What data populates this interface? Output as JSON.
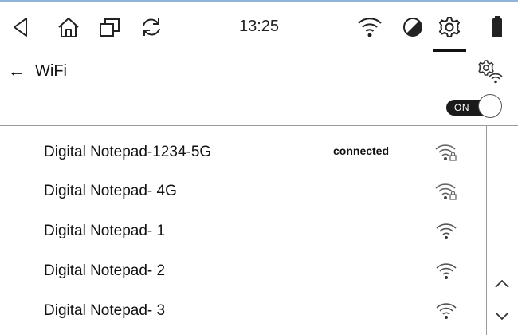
{
  "statusbar": {
    "clock": "13:25",
    "icons": [
      "back-triangle-icon",
      "home-icon",
      "recent-apps-icon",
      "refresh-icon",
      "wifi-icon",
      "contrast-icon",
      "settings-gear-icon",
      "battery-icon"
    ],
    "active_tab": "settings"
  },
  "header": {
    "back_icon": "left-arrow-icon",
    "back_glyph": "←",
    "title": "WiFi",
    "action_icon": "wifi-settings-icon"
  },
  "wifi_toggle": {
    "label": "ON",
    "state": true
  },
  "networks": [
    {
      "name": "Digital Notepad-1234-5G",
      "status": "connected",
      "secured": true
    },
    {
      "name": "Digital Notepad- 4G",
      "status": "",
      "secured": true
    },
    {
      "name": "Digital Notepad- 1",
      "status": "",
      "secured": false
    },
    {
      "name": "Digital Notepad- 2",
      "status": "",
      "secured": false
    },
    {
      "name": "Digital Notepad- 3",
      "status": "",
      "secured": false
    }
  ],
  "scroll": {
    "up_icon": "chevron-up-icon",
    "down_icon": "chevron-down-icon"
  }
}
